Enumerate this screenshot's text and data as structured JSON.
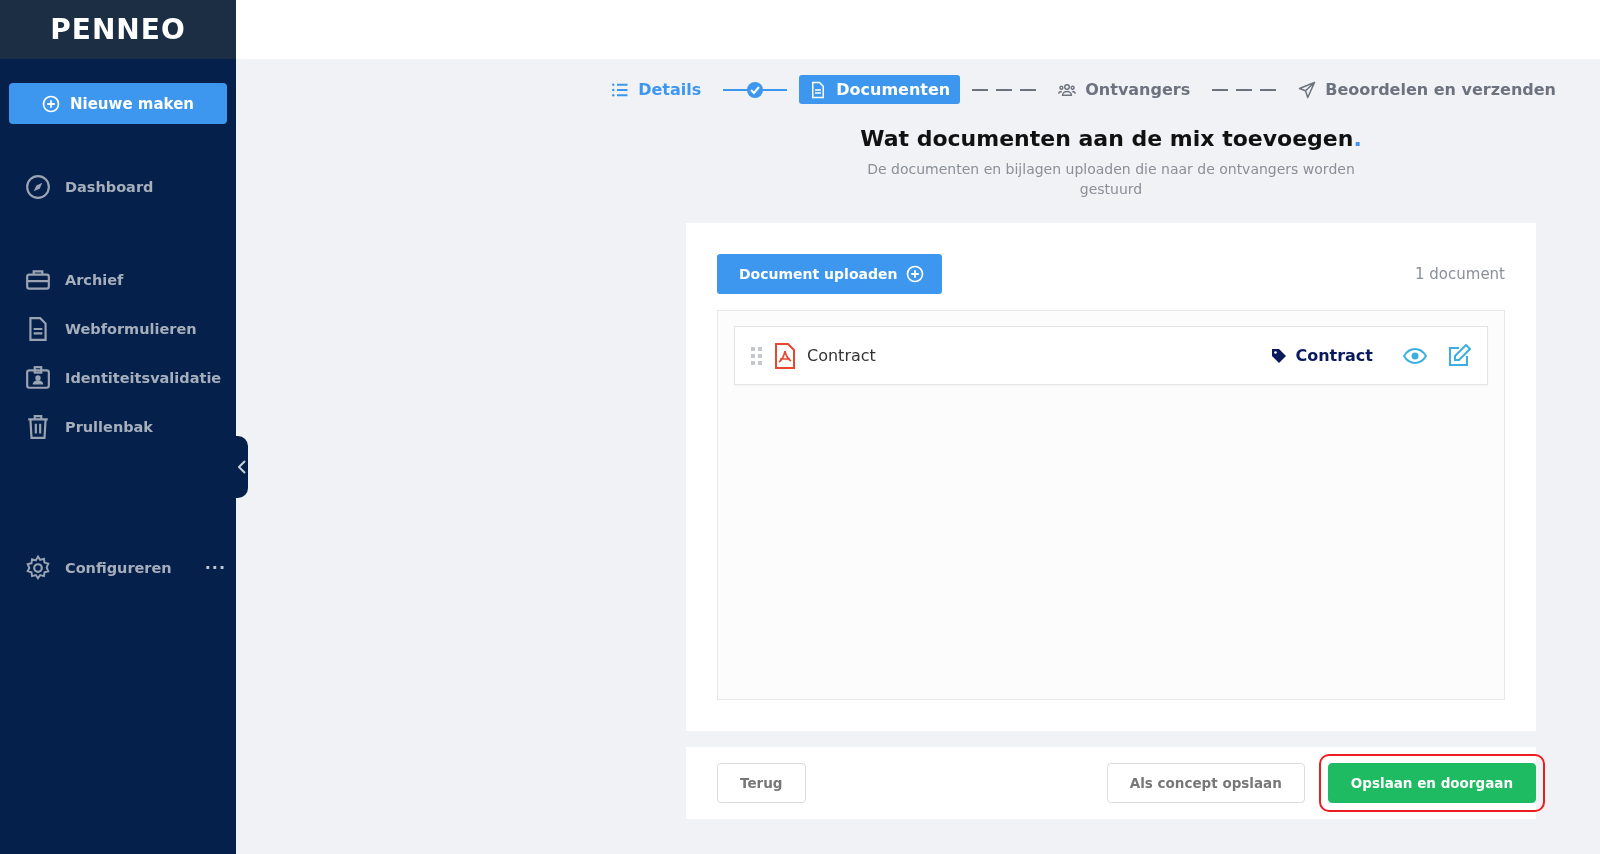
{
  "sidebar": {
    "logo": "PENNEO",
    "new_button": "Nieuwe maken",
    "sections": [
      {
        "items": [
          {
            "kind": "compass",
            "label": "Dashboard"
          }
        ]
      },
      {
        "items": [
          {
            "kind": "briefcase",
            "label": "Archief"
          },
          {
            "kind": "file",
            "label": "Webformulieren"
          },
          {
            "kind": "badge",
            "label": "Identiteitsvalidatie"
          },
          {
            "kind": "trash",
            "label": "Prullenbak"
          }
        ]
      },
      {
        "items": [
          {
            "kind": "gear",
            "label": "Configureren",
            "more": "···"
          }
        ]
      }
    ]
  },
  "stepper": [
    {
      "kind": "list",
      "label": "Details",
      "completed": true,
      "selected": false
    },
    {
      "kind": "file",
      "label": "Documenten",
      "completed": false,
      "selected": true
    },
    {
      "kind": "users",
      "label": "Ontvangers",
      "completed": false,
      "selected": false
    },
    {
      "kind": "send",
      "label": "Beoordelen en verzenden",
      "completed": false,
      "selected": false
    }
  ],
  "heading": {
    "title": "Wat documenten aan de mix toevoegen",
    "accent": ".",
    "subtitle": "De documenten en bijlagen uploaden die naar de ontvangers worden gestuurd"
  },
  "documents": {
    "upload_button": "Document uploaden",
    "count": "1 document",
    "items": [
      {
        "name": "Contract",
        "tag": "Contract"
      }
    ]
  },
  "footer": {
    "buttons": [
      {
        "label": "Terug",
        "kind": "plain",
        "highlighted": false
      },
      {
        "label": "Als concept opslaan",
        "kind": "plain",
        "highlighted": false
      },
      {
        "label": "Opslaan en doorgaan",
        "kind": "primary",
        "highlighted": true
      }
    ]
  }
}
